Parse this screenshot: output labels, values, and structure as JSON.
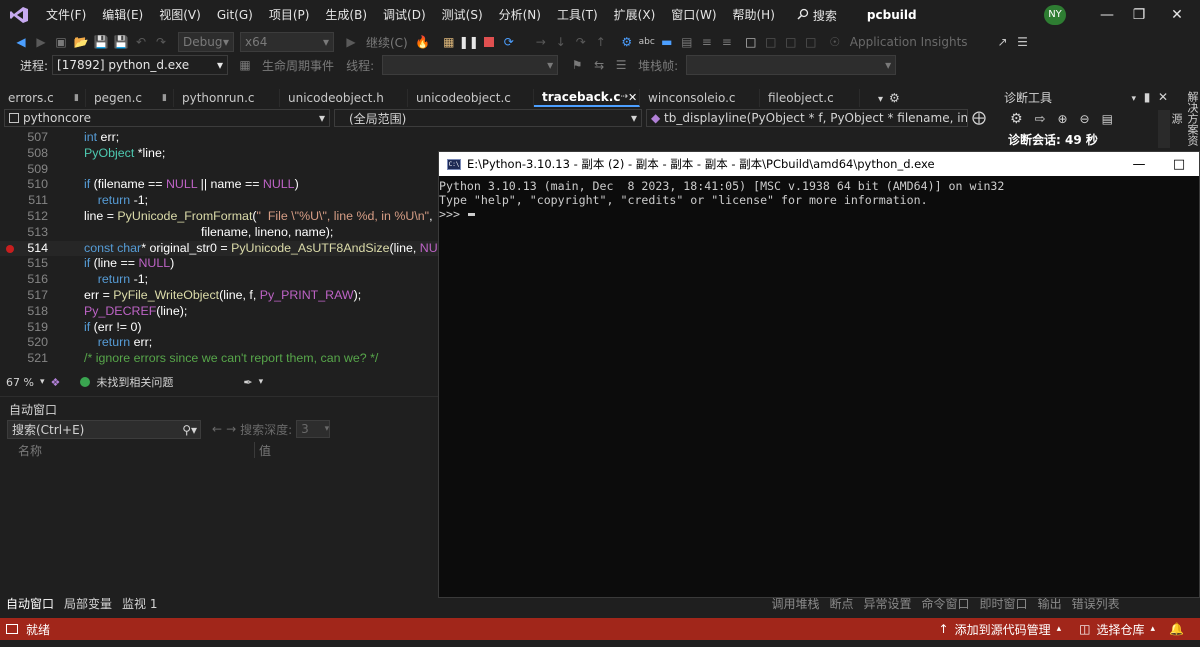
{
  "menubar": {
    "items": [
      "文件(F)",
      "编辑(E)",
      "视图(V)",
      "Git(G)",
      "项目(P)",
      "生成(B)",
      "调试(D)",
      "测试(S)",
      "分析(N)",
      "工具(T)",
      "扩展(X)",
      "窗口(W)",
      "帮助(H)"
    ],
    "search_label": "搜索",
    "solution_name": "pcbuild",
    "user_initials": "NY"
  },
  "toolbar": {
    "config": "Debug",
    "platform": "x64",
    "continue_label": "继续(C)",
    "app_insights": "Application Insights"
  },
  "debugbar": {
    "process_label": "进程:",
    "process_value": "[17892] python_d.exe",
    "lifecycle_label": "生命周期事件",
    "thread_label": "线程:",
    "stackframe_label": "堆栈帧:"
  },
  "tabs": [
    {
      "label": "errors.c",
      "active": false
    },
    {
      "label": "pegen.c",
      "active": false
    },
    {
      "label": "pythonrun.c",
      "active": false
    },
    {
      "label": "unicodeobject.h",
      "active": false
    },
    {
      "label": "unicodeobject.c",
      "active": false
    },
    {
      "label": "traceback.c",
      "active": true
    },
    {
      "label": "winconsoleio.c",
      "active": false
    },
    {
      "label": "fileobject.c",
      "active": false
    }
  ],
  "navbar": {
    "project": "pythoncore",
    "scope": "(全局范围)",
    "function": "tb_displayline(PyObject * f, PyObject * filename, int lineno"
  },
  "editor": {
    "line_numbers": [
      "507",
      "508",
      "509",
      "510",
      "511",
      "512",
      "513",
      "514",
      "515",
      "516",
      "517",
      "518",
      "519",
      "520",
      "521"
    ],
    "zoom": "67 %",
    "issues": "未找到相关问题"
  },
  "autos": {
    "title": "自动窗口",
    "search_placeholder": "搜索(Ctrl+E)",
    "search_depth_label": "搜索深度:",
    "search_depth_value": "3",
    "col_name": "名称",
    "col_value": "值"
  },
  "bottom_tabs": {
    "left": [
      "自动窗口",
      "局部变量",
      "监视 1"
    ],
    "right": [
      "调用堆栈",
      "断点",
      "异常设置",
      "命令窗口",
      "即时窗口",
      "输出",
      "错误列表"
    ]
  },
  "console": {
    "title": "E:\\Python-3.10.13 - 副本 (2) - 副本 - 副本 - 副本 - 副本\\PCbuild\\amd64\\python_d.exe",
    "line1": "Python 3.10.13 (main, Dec  8 2023, 18:41:05) [MSC v.1938 64 bit (AMD64)] on win32",
    "line2": "Type \"help\", \"copyright\", \"credits\" or \"license\" for more information.",
    "prompt": ">>>"
  },
  "diagnostics": {
    "title": "诊断工具",
    "session": "诊断会话: 49 秒",
    "side_strip": "解决方案资源"
  },
  "statusbar": {
    "ready": "就绪",
    "add_source": "添加到源代码管理",
    "select_repo": "选择仓库"
  },
  "colors": {
    "status_bar": "#a1261a",
    "accent": "#4c9fff",
    "breakpoint": "#c81e1e"
  }
}
